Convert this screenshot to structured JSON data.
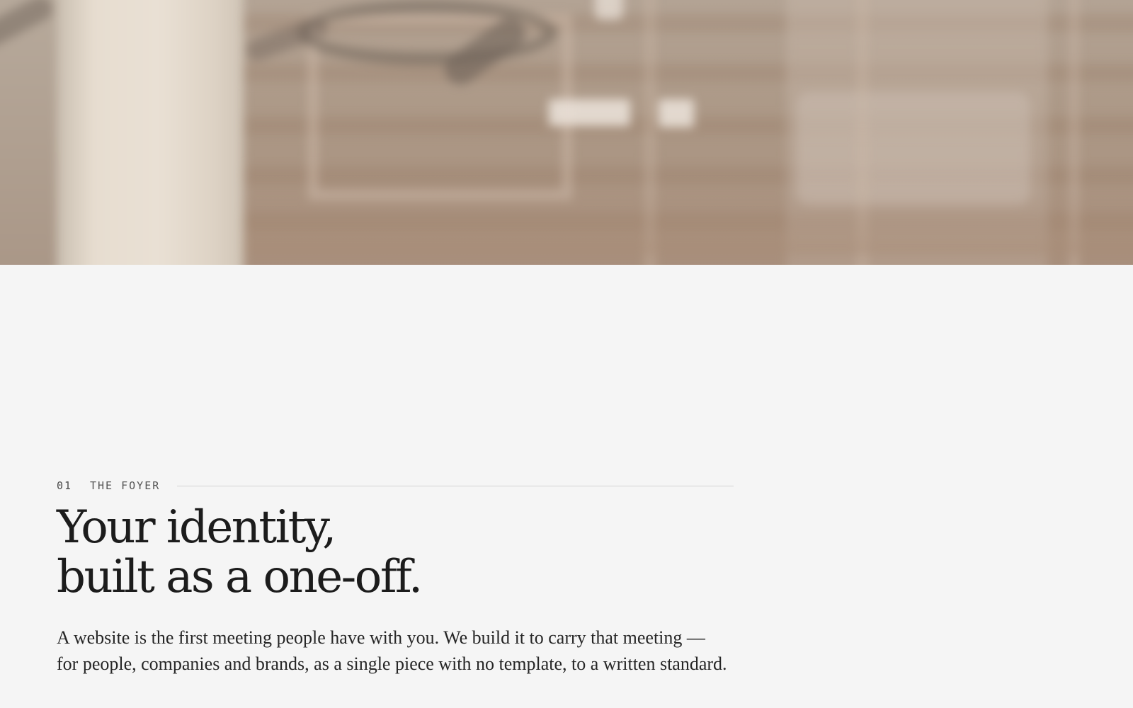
{
  "hero": {
    "icon": "interior-photo",
    "tones": [
      "#b3a394",
      "#e9e0d4",
      "#a88f7c"
    ]
  },
  "section": {
    "number": "01",
    "label": "THE FOYER",
    "headline": {
      "line1": "Your identity,",
      "line2": "built as a one-off."
    },
    "body": "A website is the first meeting people have with you. We build it to carry that meeting — for people, companies and brands, as a single piece with no template, to a written standard."
  },
  "colors": {
    "background": "#f5f5f5",
    "heading": "#1c1c1c",
    "body": "#262626",
    "eyebrow": "#4b4b4b",
    "rule": "#d2d2d2"
  }
}
